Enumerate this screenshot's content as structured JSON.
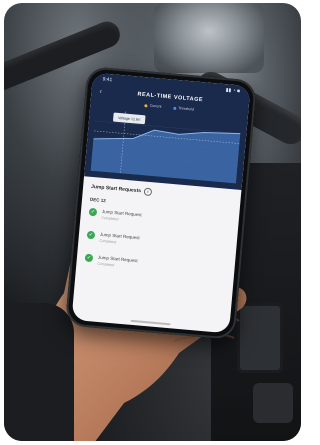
{
  "photo": {
    "subject": "hand holding smartphone above car engine bay"
  },
  "phone": {
    "status": {
      "time": "9:41",
      "icons": "▮▮ ◔ ■"
    },
    "title": "REAL-TIME VOLTAGE",
    "legend": [
      {
        "label": "Current",
        "color": "#e8b53a"
      },
      {
        "label": "Threshold",
        "color": "#4a90e2"
      }
    ],
    "tooltip": "Voltage 12.6V",
    "section_title": "Jump Start Requests",
    "date_label": "DEC 12",
    "requests": [
      {
        "title": "Jump Start Request",
        "subtitle": "Completed"
      },
      {
        "title": "Jump Start Request",
        "subtitle": "Completed"
      },
      {
        "title": "Jump Start Request",
        "subtitle": "Completed"
      }
    ]
  },
  "colors": {
    "header": "#1a2a4c",
    "chart_fill": "#3f6fb0",
    "check": "#3aa757"
  }
}
